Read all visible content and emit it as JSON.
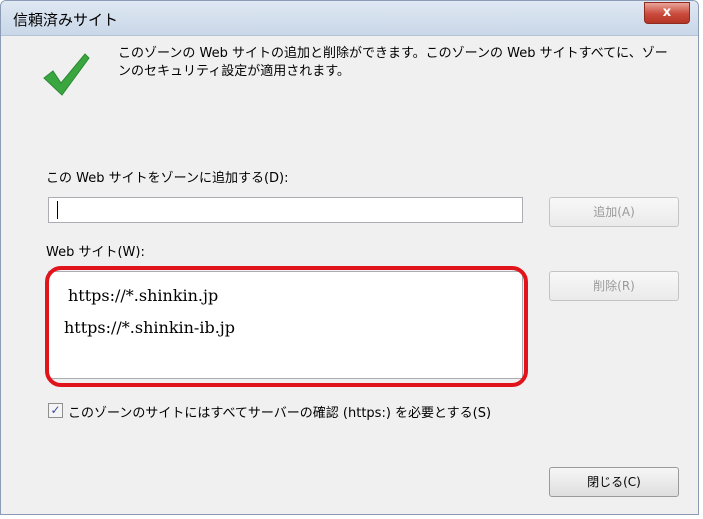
{
  "window": {
    "title": "信頼済みサイト",
    "close_label": "x"
  },
  "info": {
    "text": "このゾーンの Web サイトの追加と削除ができます。このゾーンの Web サイトすべてに、ゾーンのセキュリティ設定が適用されます。"
  },
  "add_site": {
    "label": "この Web サイトをゾーンに追加する(D):",
    "input_value": "",
    "button_label": "追加(A)"
  },
  "websites": {
    "label": "Web サイト(W):",
    "items": [
      "https://*.shinkin.jp",
      "https://*.shinkin-ib.jp"
    ],
    "remove_label": "削除(R)"
  },
  "https_check": {
    "checked": true,
    "label": "このゾーンのサイトにはすべてサーバーの確認 (https:) を必要とする(S)"
  },
  "footer": {
    "close_label": "閉じる(C)"
  },
  "colors": {
    "highlight": "#e0141a",
    "check_icon": "#3aa640"
  }
}
